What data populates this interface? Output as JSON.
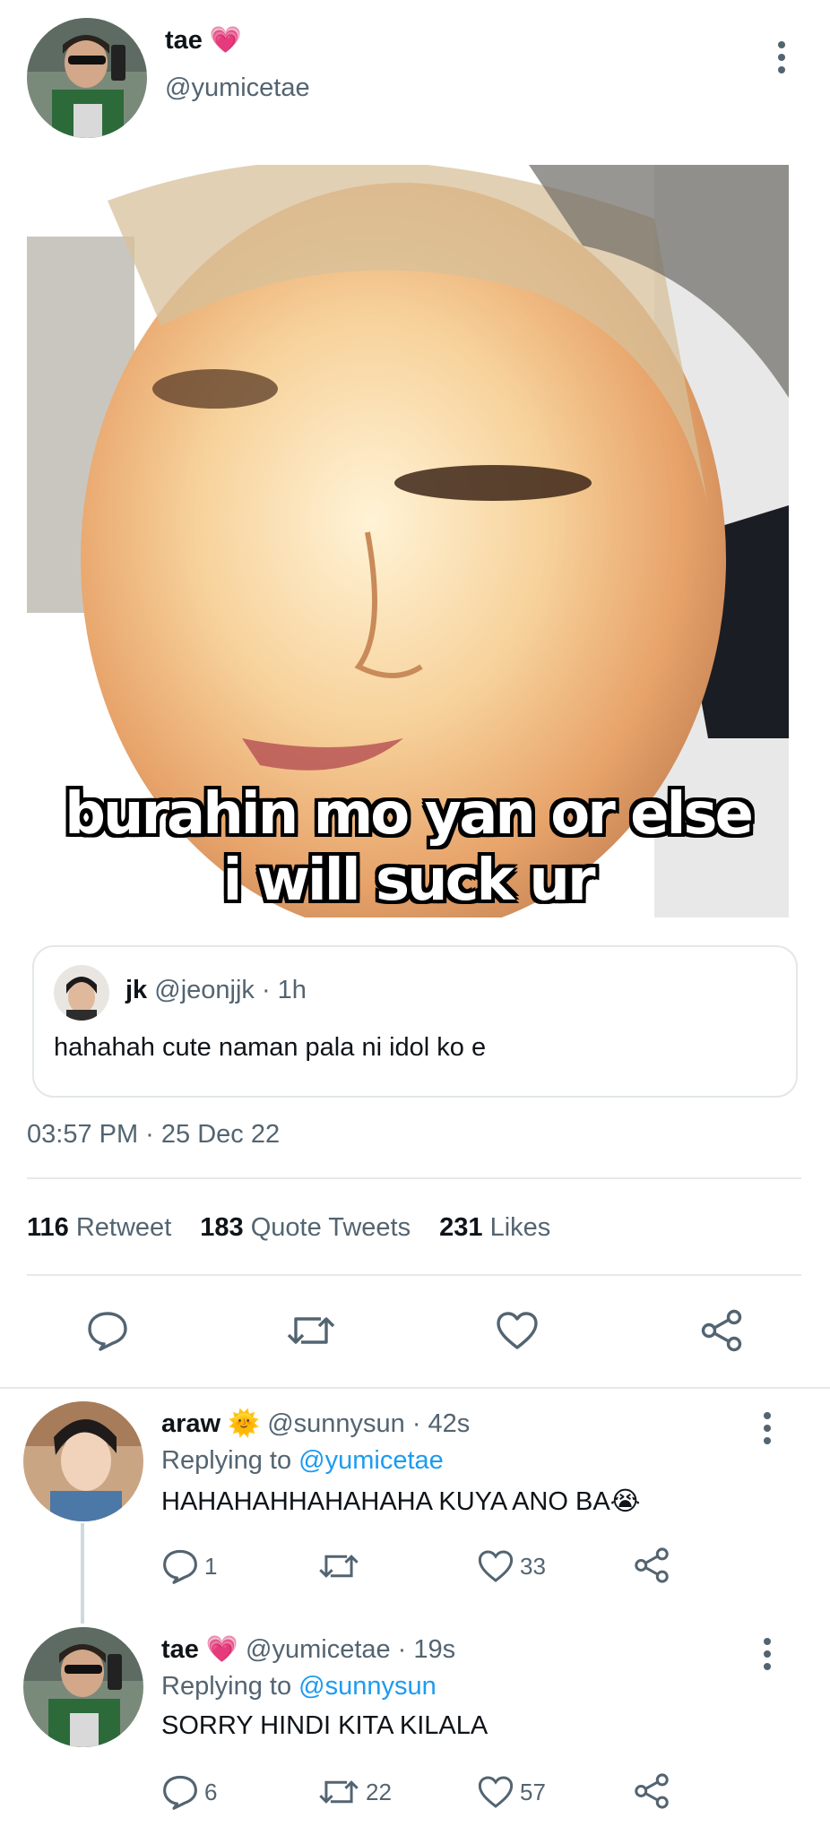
{
  "main_tweet": {
    "display_name": "tae",
    "name_emoji": "💗",
    "handle": "@yumicetae",
    "avatar_icon": "user-avatar",
    "media": {
      "caption_line1": "burahin mo yan or else",
      "caption_line2": "i will suck ur"
    },
    "quoted": {
      "display_name": "jk",
      "handle": "@jeonjjk",
      "time": "· 1h",
      "text": "hahahah cute naman pala ni idol ko e"
    },
    "timestamp": "03:57 PM · 25 Dec 22",
    "stats": {
      "retweets": "116",
      "retweets_label": "Retweet",
      "quotes": "183",
      "quotes_label": "Quote Tweets",
      "likes": "231",
      "likes_label": "Likes"
    }
  },
  "replies": [
    {
      "display_name": "araw",
      "name_emoji": "🌞",
      "handle": "@sunnysun",
      "time": "· 42s",
      "replying_label": "Replying to",
      "replying_to": "@yumicetae",
      "text": "HAHAHAHHAHAHAHA KUYA ANO BA😭",
      "replies_count": "1",
      "retweets_count": "",
      "likes_count": "33"
    },
    {
      "display_name": "tae",
      "name_emoji": "💗",
      "handle": "@yumicetae",
      "time": "· 19s",
      "replying_label": "Replying to",
      "replying_to": "@sunnysun",
      "text": "SORRY HINDI KITA KILALA",
      "replies_count": "6",
      "retweets_count": "22",
      "likes_count": "57"
    }
  ],
  "colors": {
    "accent": "#1d9bf0",
    "muted": "#536471",
    "divider": "#e6e9eb"
  }
}
